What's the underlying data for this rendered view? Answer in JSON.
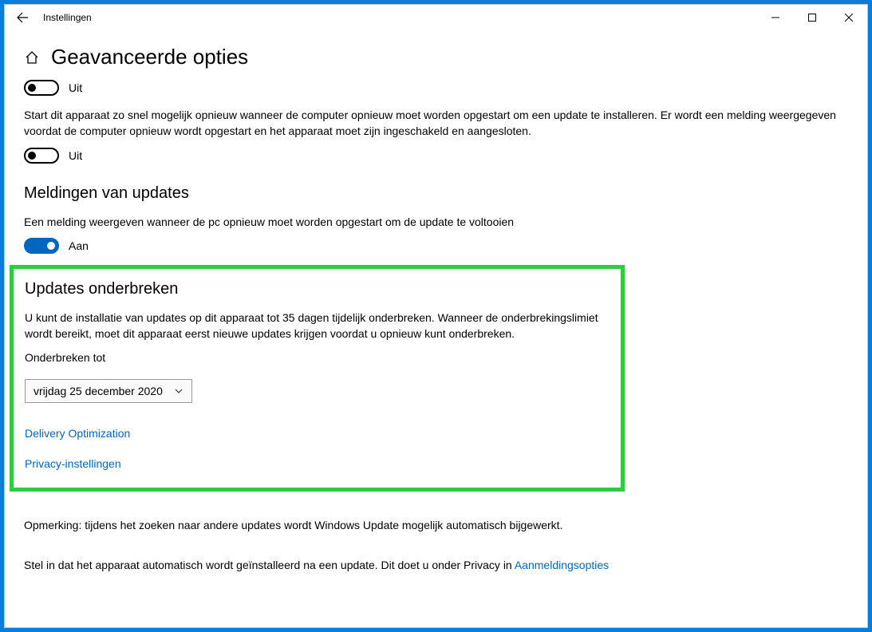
{
  "titlebar": {
    "title": "Instellingen"
  },
  "page": {
    "title": "Geavanceerde opties"
  },
  "truncated_text_hint": "",
  "toggle1": {
    "state_label": "Uit"
  },
  "restart_desc": "Start dit apparaat zo snel mogelijk opnieuw wanneer de computer opnieuw moet worden opgestart om een update te installeren. Er wordt een melding weergegeven voordat de computer opnieuw wordt opgestart en het apparaat moet zijn ingeschakeld en aangesloten.",
  "toggle2": {
    "state_label": "Uit"
  },
  "notifications": {
    "heading": "Meldingen van updates",
    "desc": "Een melding weergeven wanneer de pc opnieuw moet worden opgestart om de update te voltooien",
    "state_label": "Aan"
  },
  "pause": {
    "heading": "Updates onderbreken",
    "desc": "U kunt de installatie van updates op dit apparaat tot 35 dagen tijdelijk onderbreken. Wanneer de onderbrekingslimiet wordt bereikt, moet dit apparaat eerst nieuwe updates krijgen voordat u opnieuw kunt onderbreken.",
    "label": "Onderbreken tot",
    "dropdown_value": "vrijdag 25 december 2020",
    "link_delivery": "Delivery Optimization",
    "link_privacy": "Privacy-instellingen"
  },
  "footer": {
    "note1": "Opmerking: tijdens het zoeken naar andere updates wordt Windows Update mogelijk automatisch bijgewerkt.",
    "note2_prefix": "Stel in dat het apparaat automatisch wordt geïnstalleerd na een update. Dit doet u onder Privacy in ",
    "note2_link": "Aanmeldingsopties"
  }
}
